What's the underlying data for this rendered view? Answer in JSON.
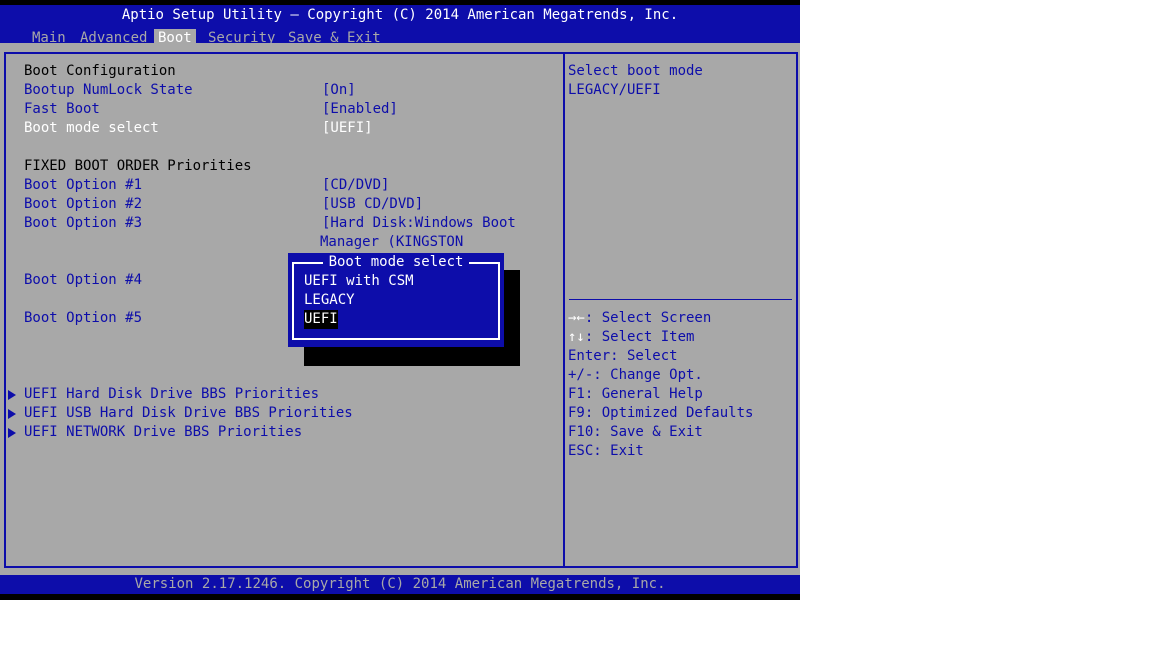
{
  "header": {
    "title": "Aptio Setup Utility – Copyright (C) 2014 American Megatrends, Inc."
  },
  "tabs": [
    {
      "label": "Main",
      "active": false
    },
    {
      "label": "Advanced",
      "active": false
    },
    {
      "label": "Boot",
      "active": true
    },
    {
      "label": "Security",
      "active": false
    },
    {
      "label": "Save & Exit",
      "active": false
    }
  ],
  "boot_config": {
    "heading": "Boot Configuration",
    "numlock": {
      "label": "Bootup NumLock State",
      "value": "[On]"
    },
    "fast_boot": {
      "label": "Fast Boot",
      "value": "[Enabled]"
    },
    "boot_mode": {
      "label": "Boot mode select",
      "value": "[UEFI]"
    }
  },
  "boot_order": {
    "heading": "FIXED BOOT ORDER Priorities",
    "options": [
      {
        "label": "Boot Option #1",
        "value": "[CD/DVD]"
      },
      {
        "label": "Boot Option #2",
        "value": "[USB CD/DVD]"
      },
      {
        "label": "Boot Option #3",
        "value": "[Hard Disk:Windows Boot",
        "value_line2": "Manager (KINGSTON"
      },
      {
        "label": "Boot Option #4",
        "value": ""
      },
      {
        "label": "Boot Option #5",
        "value": ""
      }
    ]
  },
  "submenus": [
    {
      "label": "UEFI Hard Disk Drive BBS Priorities"
    },
    {
      "label": "UEFI USB Hard Disk Drive BBS Priorities"
    },
    {
      "label": "UEFI NETWORK Drive BBS Priorities"
    }
  ],
  "help": {
    "line1": "Select boot mode",
    "line2": "LEGACY/UEFI",
    "keys": [
      {
        "key": "→←",
        "text": ": Select Screen"
      },
      {
        "key": "↑↓",
        "text": ": Select Item"
      },
      {
        "key": "",
        "text": "Enter: Select"
      },
      {
        "key": "",
        "text": "+/-: Change Opt."
      },
      {
        "key": "",
        "text": "F1: General Help"
      },
      {
        "key": "",
        "text": "F9: Optimized Defaults"
      },
      {
        "key": "",
        "text": "F10: Save & Exit"
      },
      {
        "key": "",
        "text": "ESC: Exit"
      }
    ]
  },
  "popup": {
    "title": "Boot mode select",
    "options": [
      {
        "label": "UEFI with CSM",
        "selected": false
      },
      {
        "label": "LEGACY",
        "selected": false
      },
      {
        "label": "UEFI",
        "selected": true
      }
    ]
  },
  "footer": {
    "text": "Version 2.17.1246. Copyright (C) 2014 American Megatrends, Inc."
  },
  "colors": {
    "bios_blue": "#0d0daa",
    "panel_gray": "#a8a8a8",
    "highlight_white": "#ffffff"
  }
}
